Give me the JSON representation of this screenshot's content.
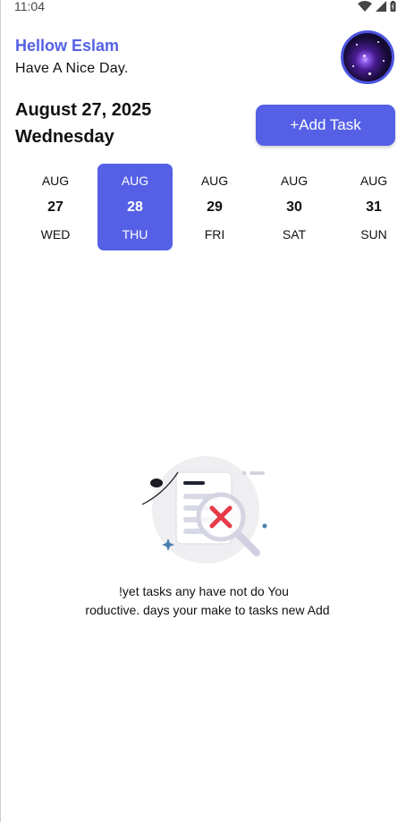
{
  "status_bar": {
    "time": "11:04",
    "icons": [
      "wifi-icon",
      "signal-icon",
      "battery-icon"
    ]
  },
  "header": {
    "greeting": "Hellow Eslam",
    "subtitle": "Have A Nice Day.",
    "avatar": "galaxy-avatar"
  },
  "date_info": {
    "date": "August 27, 2025",
    "weekday": "Wednesday"
  },
  "add_task": {
    "label": "+Add Task"
  },
  "date_picker": {
    "days": [
      {
        "month": "AUG",
        "day": "27",
        "weekday": "WED",
        "selected": false
      },
      {
        "month": "AUG",
        "day": "28",
        "weekday": "THU",
        "selected": true
      },
      {
        "month": "AUG",
        "day": "29",
        "weekday": "FRI",
        "selected": false
      },
      {
        "month": "AUG",
        "day": "30",
        "weekday": "SAT",
        "selected": false
      },
      {
        "month": "AUG",
        "day": "31",
        "weekday": "SUN",
        "selected": false
      }
    ]
  },
  "empty_state": {
    "icon": "no-tasks-search-icon",
    "line1": "!yet tasks any have not do You",
    "line2": "roductive. days your make to tasks new Add"
  },
  "colors": {
    "accent": "#5560e6",
    "text": "#111111",
    "background": "#ffffff"
  }
}
